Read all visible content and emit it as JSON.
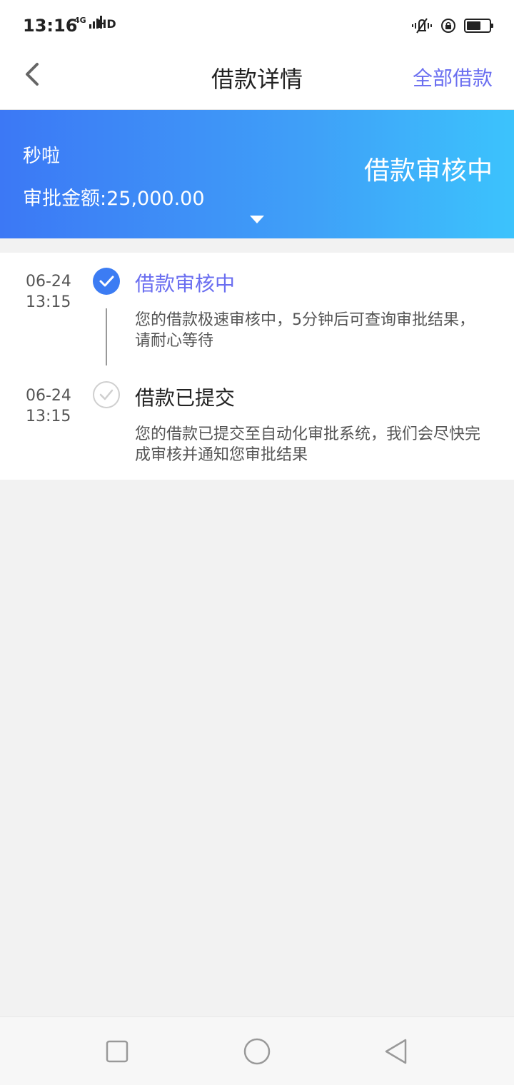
{
  "status_bar": {
    "time": "13:16",
    "network_label": "4G",
    "hd_label": "HD",
    "icons": [
      "signal-icon",
      "hd-call-icon",
      "vibrate-icon",
      "rotation-lock-icon",
      "battery-icon"
    ],
    "battery_level": 0.55
  },
  "nav": {
    "title": "借款详情",
    "action_label": "全部借款",
    "back_icon": "chevron-left-icon"
  },
  "banner": {
    "product_name": "秒啦",
    "amount_text": "审批金额:25,000.00",
    "status_text": "借款审核中",
    "expand_icon": "caret-down-icon"
  },
  "timeline": {
    "items": [
      {
        "date": "06-24",
        "time": "13:15",
        "title": "借款审核中",
        "description": "您的借款极速审核中，5分钟后可查询审批结果，请耐心等待",
        "state": "active",
        "icon": "check-circle-filled-icon"
      },
      {
        "date": "06-24",
        "time": "13:15",
        "title": "借款已提交",
        "description": "您的借款已提交至自动化审批系统，我们会尽快完成审核并通知您审批结果",
        "state": "done",
        "icon": "check-circle-outline-icon"
      }
    ]
  },
  "bottom_nav": {
    "buttons": [
      "recent-apps-icon",
      "home-icon",
      "back-triangle-icon"
    ]
  },
  "colors": {
    "accent": "#6a6ef0",
    "banner_start": "#3c78f5",
    "banner_end": "#3cc3fc",
    "check_active": "#3c7cf3",
    "background": "#f2f2f2"
  }
}
